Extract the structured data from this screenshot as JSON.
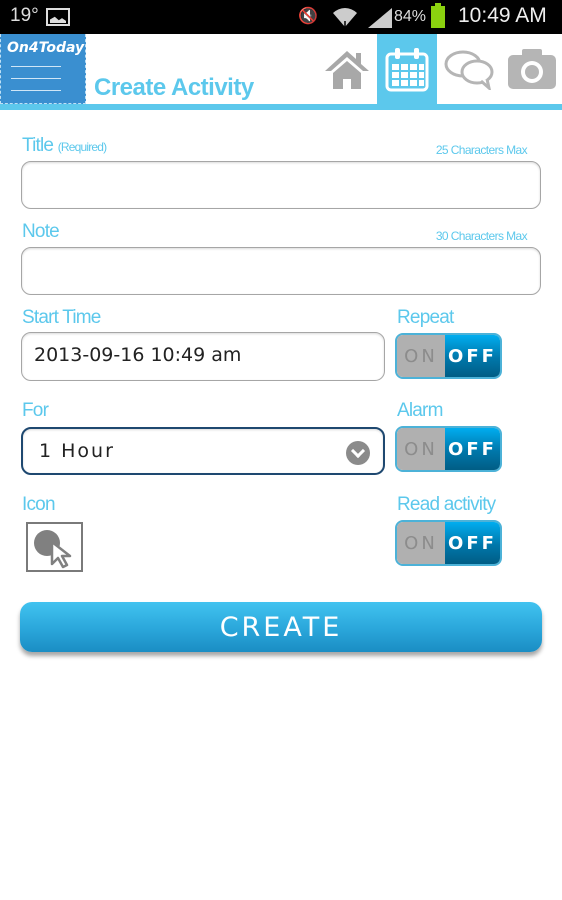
{
  "status_bar": {
    "temperature": "19°",
    "battery_percent": "84%",
    "time": "10:49 AM",
    "icons": [
      "gallery-icon",
      "mute-icon",
      "wifi-icon",
      "signal-icon",
      "battery-icon"
    ]
  },
  "app_bar": {
    "logo_text": "On4Today",
    "title": "Create Activity",
    "nav": [
      {
        "name": "home",
        "icon": "home-icon",
        "active": false
      },
      {
        "name": "calendar",
        "icon": "calendar-icon",
        "active": true
      },
      {
        "name": "chat",
        "icon": "chat-icon",
        "active": false
      },
      {
        "name": "camera",
        "icon": "camera-icon",
        "active": false
      }
    ],
    "accent_color": "#5cc8ec"
  },
  "form": {
    "title": {
      "label": "Title",
      "sub_label": "(Required)",
      "hint": "25 Characters Max",
      "value": "",
      "placeholder": ""
    },
    "note": {
      "label": "Note",
      "hint": "30 Characters Max",
      "value": "",
      "placeholder": ""
    },
    "start_time": {
      "label": "Start Time",
      "value": "2013-09-16 10:49 am"
    },
    "for": {
      "label": "For",
      "selected": "1 Hour"
    },
    "icon": {
      "label": "Icon",
      "icon": "select-icon-cursor"
    },
    "repeat": {
      "label": "Repeat",
      "on_label": "ON",
      "off_label": "OFF",
      "state": "OFF"
    },
    "alarm": {
      "label": "Alarm",
      "on_label": "ON",
      "off_label": "OFF",
      "state": "OFF"
    },
    "read_activity": {
      "label": "Read activity",
      "on_label": "ON",
      "off_label": "OFF",
      "state": "OFF"
    }
  },
  "create_button": {
    "label": "CREATE"
  }
}
